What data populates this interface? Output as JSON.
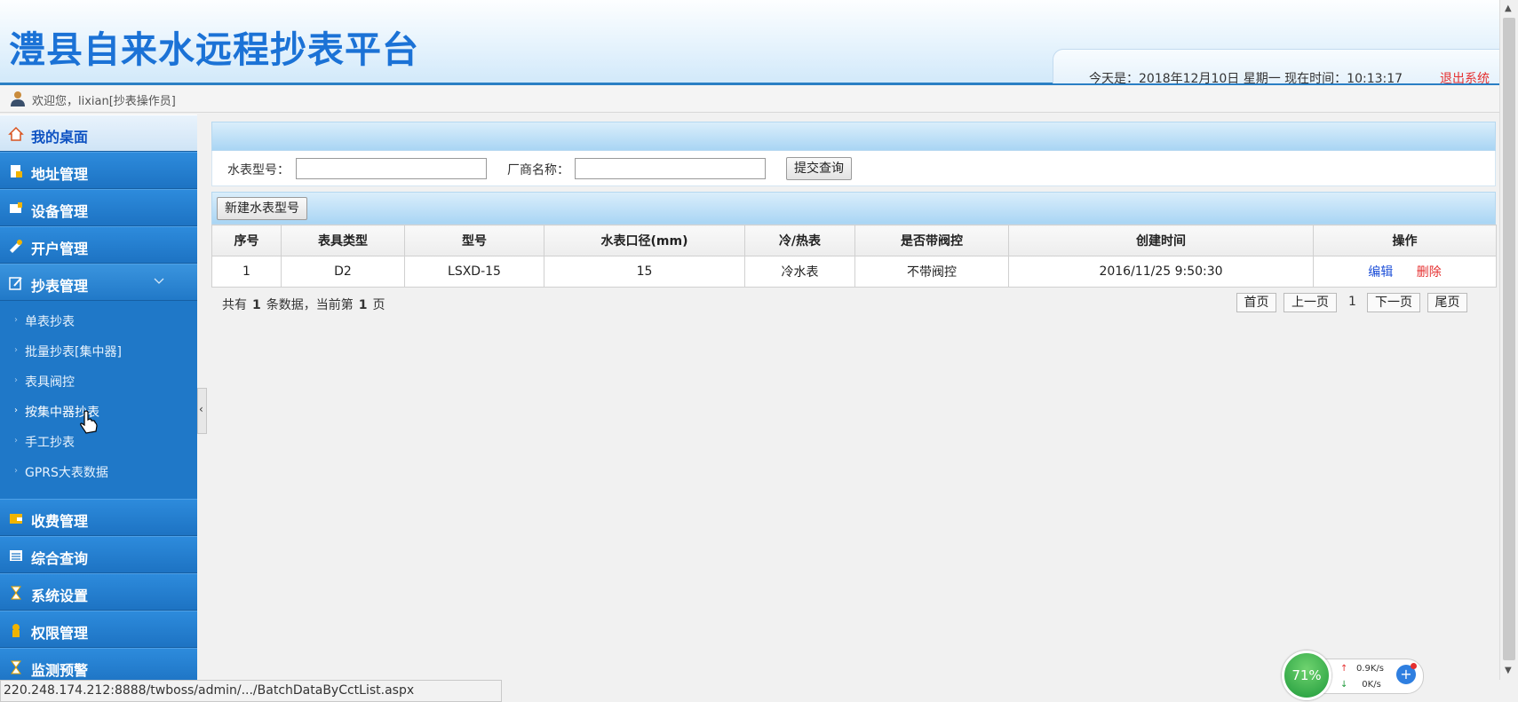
{
  "header": {
    "title": "澧县自来水远程抄表平台",
    "date_text": "今天是：2018年12月10日 星期一 现在时间：10:13:17",
    "logout_label": "退出系统"
  },
  "welcome": {
    "text": "欢迎您，lixian[抄表操作员]",
    "icon": "user-icon"
  },
  "sidebar": {
    "items": [
      {
        "label": "我的桌面",
        "icon": "home-icon"
      },
      {
        "label": "地址管理",
        "icon": "document-icon"
      },
      {
        "label": "设备管理",
        "icon": "device-icon"
      },
      {
        "label": "开户管理",
        "icon": "account-icon"
      },
      {
        "label": "抄表管理",
        "icon": "edit-icon"
      },
      {
        "label": "收费管理",
        "icon": "wallet-icon"
      },
      {
        "label": "综合查询",
        "icon": "list-icon"
      },
      {
        "label": "系统设置",
        "icon": "hourglass-icon"
      },
      {
        "label": "权限管理",
        "icon": "lock-icon"
      },
      {
        "label": "监测预警",
        "icon": "hourglass-icon"
      }
    ],
    "submenu": [
      {
        "label": "单表抄表"
      },
      {
        "label": "批量抄表[集中器]"
      },
      {
        "label": "表具阀控"
      },
      {
        "label": "按集中器抄表"
      },
      {
        "label": "手工抄表"
      },
      {
        "label": "GPRS大表数据"
      }
    ],
    "collapse_glyph": "‹"
  },
  "search": {
    "meter_model_label": "水表型号：",
    "meter_model_value": "",
    "vendor_label": "厂商名称：",
    "vendor_value": "",
    "submit_label": "提交查询"
  },
  "toolbar": {
    "new_label": "新建水表型号"
  },
  "table": {
    "columns": [
      "序号",
      "表具类型",
      "型号",
      "水表口径(mm)",
      "冷/热表",
      "是否带阀控",
      "创建时间",
      "操作"
    ],
    "rows": [
      {
        "index": "1",
        "type": "D2",
        "model": "LSXD-15",
        "caliber": "15",
        "hot_cold": "冷水表",
        "valve": "不带阀控",
        "created": "2016/11/25 9:50:30",
        "edit": "编辑",
        "delete": "删除"
      }
    ]
  },
  "pagination": {
    "summary_prefix": "共有",
    "total": "1",
    "summary_mid": "条数据，当前第",
    "current_page": "1",
    "summary_suffix": "页",
    "first": "首页",
    "prev": "上一页",
    "page": "1",
    "next": "下一页",
    "last": "尾页"
  },
  "status_bar": {
    "url": "220.248.174.212:8888/twboss/admin/.../BatchDataByCctList.aspx"
  },
  "net_monitor": {
    "percent": "71%",
    "up_speed": "0.9K/s",
    "down_speed": "0K/s",
    "up_arrow": "↑",
    "down_arrow": "↓",
    "plus": "+"
  },
  "colors": {
    "brand_blue": "#1b72d6",
    "sidebar_blue": "#1f78c8",
    "danger_red": "#e53030",
    "link_blue": "#1d4fd8"
  }
}
